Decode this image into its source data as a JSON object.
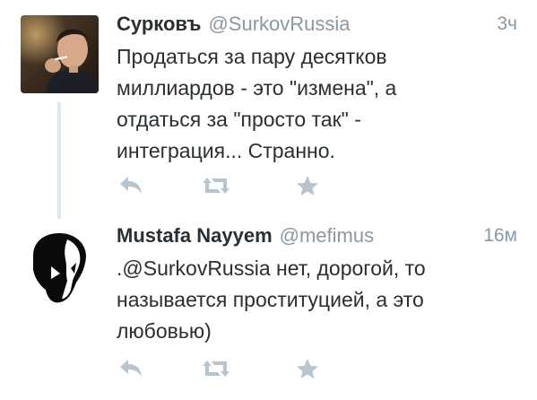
{
  "tweets": [
    {
      "display_name": "Сурковъ",
      "handle": "@SurkovRussia",
      "time": "3ч",
      "text": "Продаться за пару десятков\nмиллиардов - это \"измена\", а\nотдаться за \"просто так\" -\nинтеграция... Странно.",
      "actions": [
        "reply-icon",
        "retweet-icon",
        "favorite-icon"
      ]
    },
    {
      "display_name": "Mustafa Nayyem",
      "handle": "@mefimus",
      "time": "16м",
      "text": ".@SurkovRussia нет, дорогой, то\nназывается проституцией, а это\nлюбовью)",
      "actions": [
        "reply-icon",
        "retweet-icon",
        "favorite-icon"
      ]
    }
  ],
  "colors": {
    "text": "#292f33",
    "secondary": "#8899a6",
    "icon": "#b8c4ce",
    "thread_line": "#e1e8ed"
  }
}
